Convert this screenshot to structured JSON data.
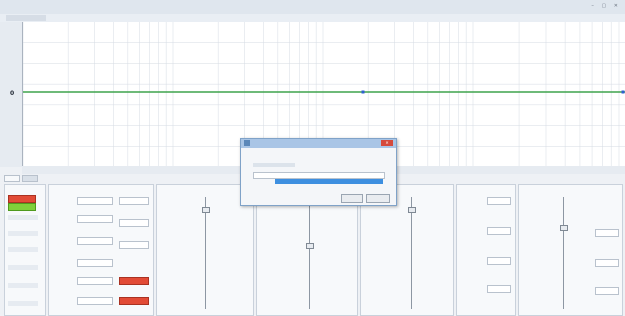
{
  "window": {
    "title": "",
    "controls": "– ▢ ✕"
  },
  "plot": {
    "yticks": [
      "",
      "",
      "",
      "0",
      "",
      "",
      ""
    ],
    "xticks": [
      "",
      "",
      "",
      ""
    ],
    "colors": {
      "signal": "#3fa34d",
      "grid": "#d5dbe3",
      "marker": "#2f5fd1"
    }
  },
  "panel": {
    "tabs": [
      "",
      ""
    ],
    "accent": "#e24b36"
  },
  "dialog": {
    "title": "",
    "field_label": "",
    "field_value": "",
    "ok_label": "",
    "cancel_label": "",
    "close_glyph": "✕"
  }
}
